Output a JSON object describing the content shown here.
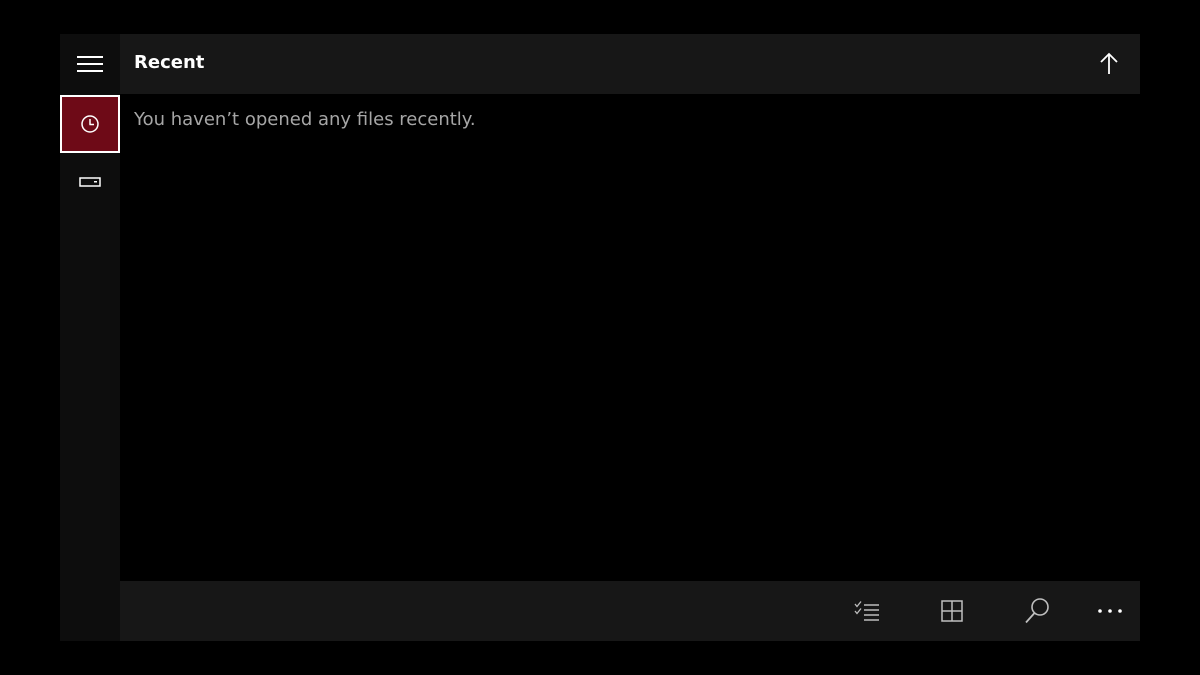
{
  "header": {
    "title": "Recent"
  },
  "content": {
    "empty_message": "You haven’t opened any files recently."
  },
  "nav": {
    "items": [
      {
        "icon": "clock-icon",
        "selected": true
      },
      {
        "icon": "drive-icon",
        "selected": false
      }
    ]
  },
  "bottom_bar": {
    "icons": [
      "select-list-icon",
      "grid-view-icon",
      "search-icon",
      "more-icon"
    ]
  },
  "colors": {
    "accent": "#6e0a17",
    "bar_background": "#171717",
    "rail_background": "#0d0d0d",
    "text_secondary": "#a6a6a6"
  }
}
